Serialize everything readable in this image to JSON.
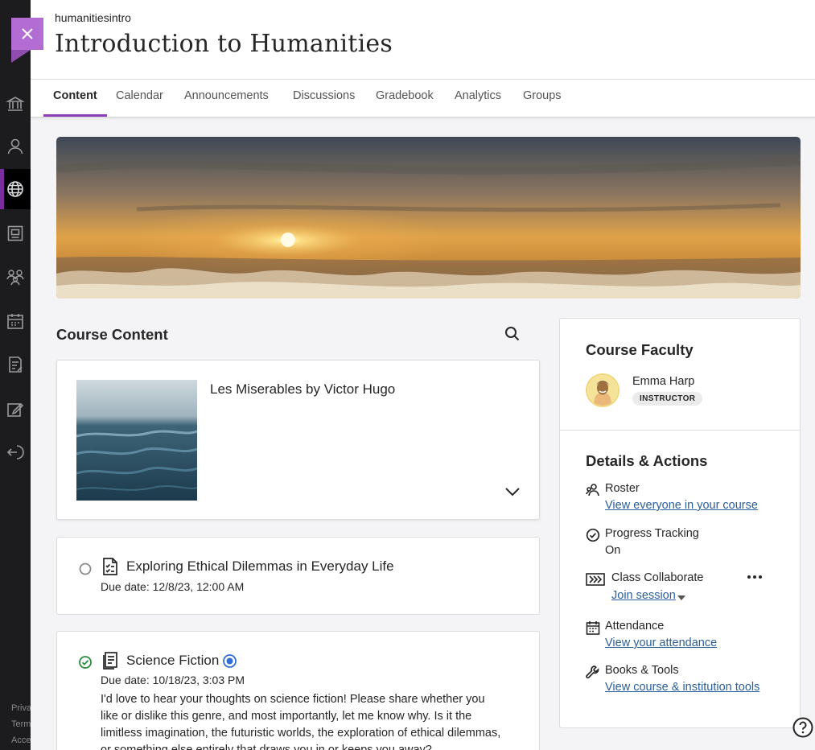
{
  "course": {
    "id": "humanitiesintro",
    "title": "Introduction to Humanities"
  },
  "tabs": [
    {
      "label": "Content",
      "active": true
    },
    {
      "label": "Calendar"
    },
    {
      "label": "Announcements"
    },
    {
      "label": "Discussions"
    },
    {
      "label": "Gradebook"
    },
    {
      "label": "Analytics"
    },
    {
      "label": "Groups"
    }
  ],
  "sidenav": {
    "icons": [
      "institution-icon",
      "profile-icon",
      "globe-icon",
      "courses-icon",
      "groups-icon",
      "calendar-icon",
      "grades-icon",
      "messages-icon",
      "sign-out-icon"
    ],
    "active": "globe-icon",
    "footer": [
      "Privacy",
      "Terms",
      "Accessibility"
    ]
  },
  "course_content": {
    "heading": "Course Content",
    "items": [
      {
        "title": "Les Miserables by Victor Hugo",
        "type": "folder"
      },
      {
        "title": "Exploring Ethical Dilemmas in Everyday Life",
        "due": "Due date: 12/8/23, 12:00 AM",
        "status": "not-started"
      },
      {
        "title": "Science Fiction",
        "due": "Due date: 10/18/23, 3:03 PM",
        "status": "completed",
        "description": "I'd love to hear your thoughts on science fiction! Please share whether you like or dislike this genre, and most importantly, let me know why. Is it the limitless imagination, the futuristic worlds, the exploration of ethical dilemmas, or something else entirely that draws you in or keeps you away?"
      }
    ]
  },
  "faculty": {
    "heading": "Course Faculty",
    "name": "Emma Harp",
    "role": "INSTRUCTOR"
  },
  "details": {
    "heading": "Details & Actions",
    "roster": {
      "label": "Roster",
      "link": "View everyone in your course"
    },
    "progress": {
      "label": "Progress Tracking",
      "value": "On"
    },
    "collaborate": {
      "label": "Class Collaborate",
      "link": "Join session"
    },
    "attendance": {
      "label": "Attendance",
      "link": "View your attendance"
    },
    "books": {
      "label": "Books & Tools",
      "link": "View course & institution tools"
    }
  },
  "colors": {
    "accent": "#8c3fb7",
    "close_button": "#b36cd4",
    "link": "#2a5e9a",
    "completed": "#2e8b3c",
    "sidenav": "#1c1c1e"
  }
}
